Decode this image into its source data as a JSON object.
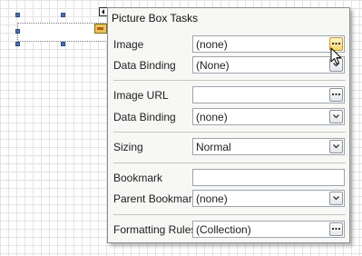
{
  "panel": {
    "title": "Picture Box Tasks",
    "rows": [
      {
        "label": "Image",
        "value": "(none)",
        "control": "ellipsis"
      },
      {
        "label": "Data Binding",
        "value": "(None)",
        "control": "dropdown"
      },
      {
        "label": "Image URL",
        "value": "",
        "control": "ellipsis"
      },
      {
        "label": "Data Binding",
        "value": "(none)",
        "control": "dropdown"
      },
      {
        "label": "Sizing",
        "value": "Normal",
        "control": "dropdown"
      },
      {
        "label": "Bookmark",
        "value": "",
        "control": "text"
      },
      {
        "label": "Parent Bookmark",
        "value": "(none)",
        "control": "dropdown"
      },
      {
        "label": "Formatting Rules",
        "value": "(Collection)",
        "control": "ellipsis"
      }
    ]
  },
  "icons": {
    "smart_tag": "chevron-left-icon",
    "ellipsis": "ellipsis-icon",
    "dropdown": "chevron-down-icon",
    "cursor": "mouse-pointer-icon",
    "picture": "picture-icon"
  },
  "colors": {
    "button_hover": "#f7d76d",
    "selection_handle": "#4b6fa8"
  }
}
